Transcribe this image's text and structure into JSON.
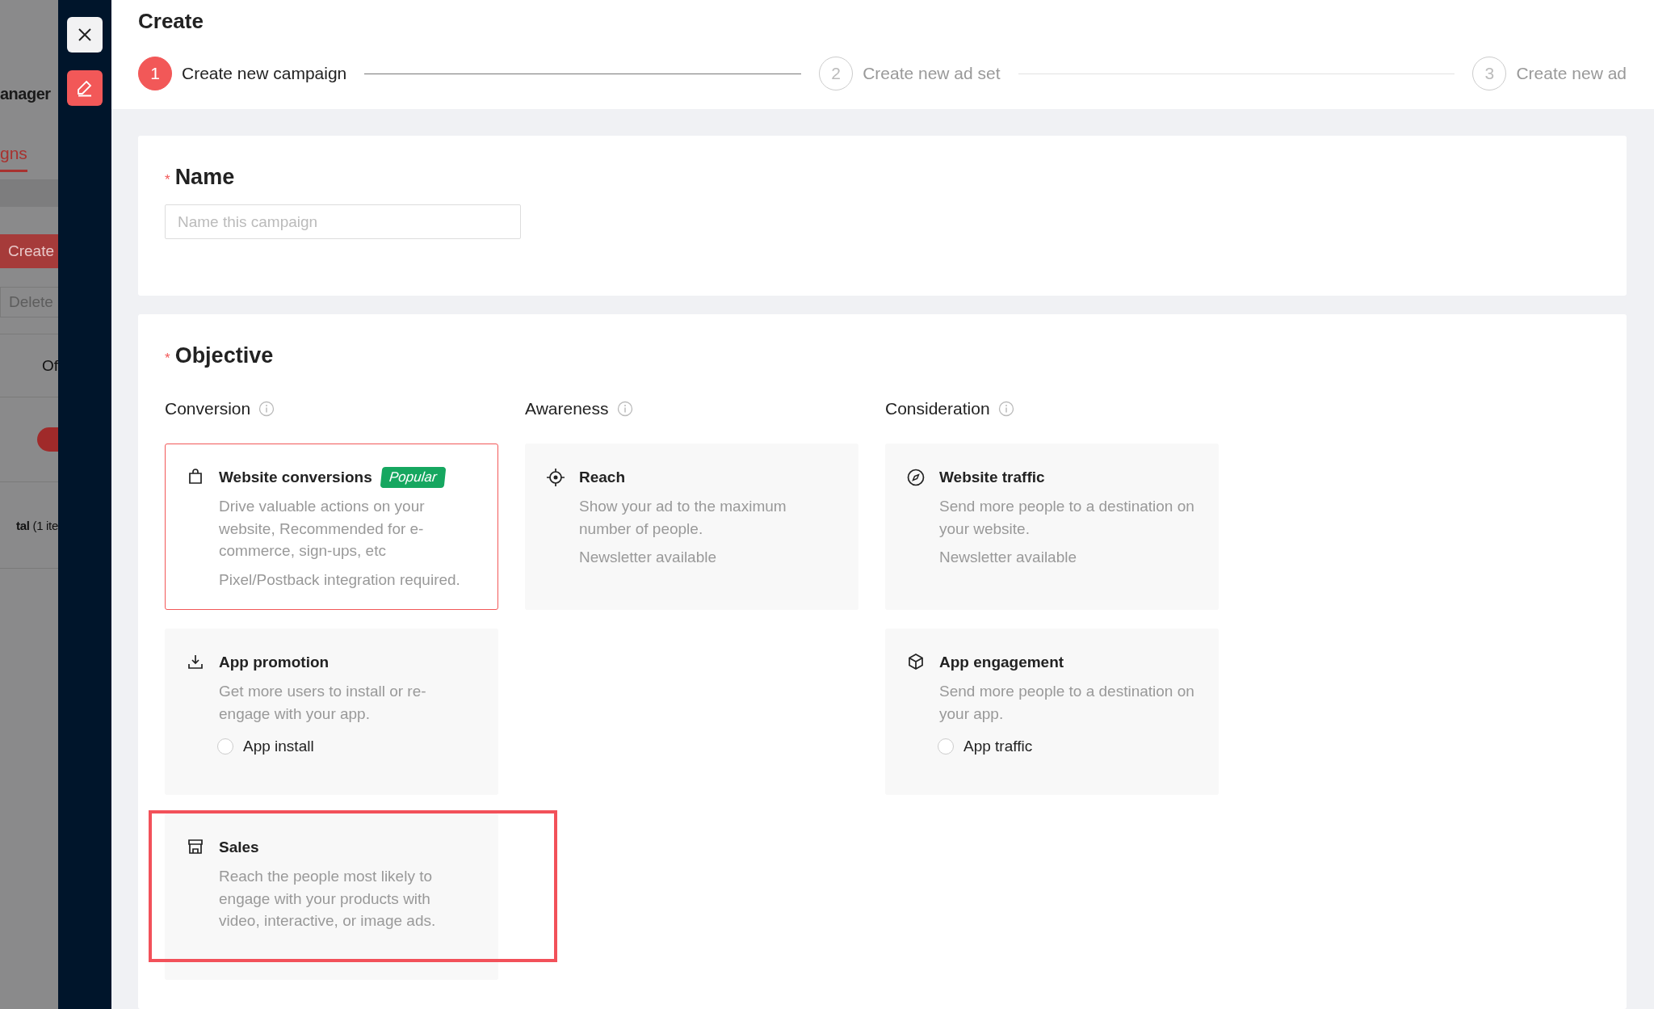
{
  "backdrop": {
    "title": "anager",
    "tab": "gns",
    "create_button": "Create",
    "delete_button": "Delete",
    "status": "Of",
    "toggle": {
      "on": true
    },
    "total": "**tal** (1 ite"
  },
  "page": {
    "title": "Create"
  },
  "steps": [
    {
      "number": "1",
      "label": "Create new campaign",
      "selected": true
    },
    {
      "number": "2",
      "label": "Create new ad set",
      "selected": false
    },
    {
      "number": "3",
      "label": "Create new ad",
      "selected": false
    }
  ],
  "name_section": {
    "required_mark": "*",
    "label": "Name",
    "placeholder": "Name this campaign"
  },
  "objective": {
    "required_mark": "*",
    "label": "Objective",
    "columns": [
      {
        "heading": "Conversion",
        "cards": [
          {
            "kind": "bag",
            "title": "Website conversions",
            "badge": "Popular",
            "description": "Drive valuable actions on your website, Recommended for e-commerce, sign-ups, etc",
            "note": "Pixel/Postback integration required.",
            "selected": true,
            "highlighted": false
          },
          {
            "kind": "download",
            "title": "App promotion",
            "description": "Get more users to install or re-engage with your app.",
            "options": [
              {
                "label": "App install",
                "selected": false
              }
            ],
            "selected": false,
            "highlighted": false
          },
          {
            "kind": "store",
            "title": "Sales",
            "description": "Reach the people most likely to engage with your products with video, interactive, or image ads.",
            "selected": false,
            "highlighted": true
          }
        ]
      },
      {
        "heading": "Awareness",
        "cards": [
          {
            "kind": "target",
            "title": "Reach",
            "description": "Show your ad to the maximum number of people.",
            "note": "Newsletter available",
            "selected": false,
            "highlighted": false
          }
        ]
      },
      {
        "heading": "Consideration",
        "cards": [
          {
            "kind": "compass",
            "title": "Website traffic",
            "description": "Send more people to a destination on your website.",
            "note": "Newsletter available",
            "selected": false,
            "highlighted": false
          },
          {
            "kind": "cube",
            "title": "App engagement",
            "description": "Send more people to a destination on your app.",
            "options": [
              {
                "label": "App traffic",
                "selected": false
              }
            ],
            "selected": false,
            "highlighted": false
          }
        ]
      }
    ]
  }
}
